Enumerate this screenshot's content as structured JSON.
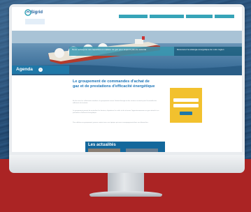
{
  "site": {
    "logo": {
      "name": "Sigrid",
      "tagline": ""
    },
    "nav": [
      "",
      "",
      "",
      ""
    ],
    "hero": {
      "caption": "Nous renforçons nos capacités en matière de gaz pour toujours plus de sécurité",
      "side_caption": "Découvrez la stratégie énergétique de votre région"
    },
    "agenda": {
      "label": "Agenda",
      "arrow": "›"
    },
    "article": {
      "title": "Le groupement de commandes d'achat de gaz et de prestations d'efficacité énergétique",
      "paragraphs": [
        "En lien avec les collectivités membres, le groupement assure l'achat d'énergie et des services associés pour l'ensemble des adhérents du territoire.",
        "Le groupement permet de mutualiser les besoins, d'optimiser les coûts et de sécuriser l'approvisionnement en gaz naturel et en prestations d'efficacité énergétique.",
        "Pour adhérer au groupement, prenez contact avec nos équipes qui vous accompagneront dans vos démarches."
      ]
    },
    "news": {
      "title": "Les actualités"
    },
    "form": {
      "title": "",
      "input1_placeholder": "",
      "input2_placeholder": "",
      "button_label": ""
    }
  },
  "colors": {
    "primary": "#1b75b8",
    "accent_teal": "#36a4b8",
    "form_yellow": "#f2c12e",
    "backdrop_red": "#ab2424"
  }
}
